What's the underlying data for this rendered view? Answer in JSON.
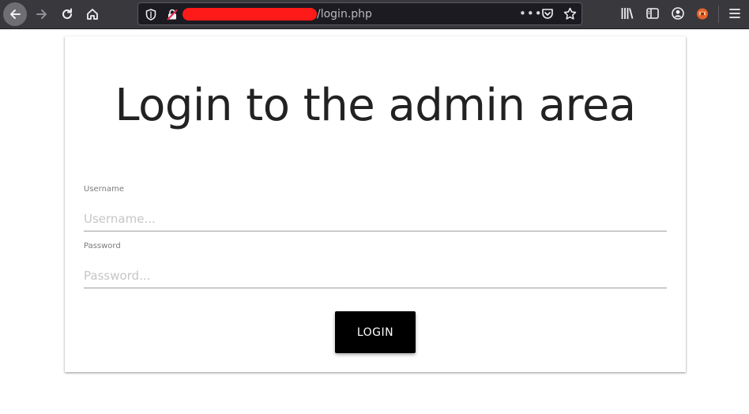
{
  "browser": {
    "url_suffix": "/login.php",
    "url_dots": "•••",
    "colors": {
      "toolbar_bg": "#38383d",
      "urlbar_bg": "#1c1b22",
      "redaction": "#ff1a1a"
    },
    "icons": [
      "back-arrow-icon",
      "forward-arrow-icon",
      "reload-icon",
      "home-icon",
      "shield-icon",
      "insecure-lock-icon",
      "page-actions-icon",
      "pocket-icon",
      "bookmark-star-icon",
      "library-icon",
      "sidebar-icon",
      "account-icon",
      "extension-icon",
      "hamburger-menu-icon"
    ]
  },
  "page": {
    "title": "Login to the admin area",
    "username": {
      "label": "Username",
      "placeholder": "Username...",
      "value": ""
    },
    "password": {
      "label": "Password",
      "placeholder": "Password...",
      "value": ""
    },
    "login_button": "LOGIN",
    "colors": {
      "button_bg": "#000000",
      "title": "#222222"
    }
  }
}
